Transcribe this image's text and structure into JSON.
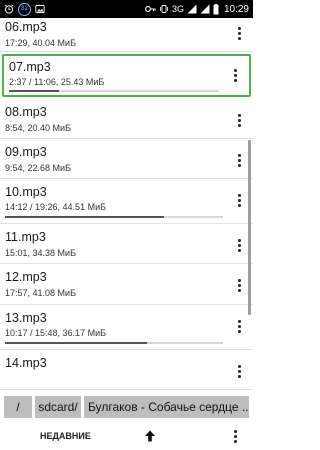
{
  "status_bar": {
    "badge_number": "82",
    "network": "3G",
    "time": "10:29"
  },
  "tracks": [
    {
      "name": "06.mp3",
      "info": "17:29, 40.04 МиБ",
      "progress": 0
    },
    {
      "name": "07.mp3",
      "info": "2:37 / 11:06, 25.43 МиБ",
      "progress": 0.24,
      "selected": true
    },
    {
      "name": "08.mp3",
      "info": "8:54, 20.40 МиБ",
      "progress": 0
    },
    {
      "name": "09.mp3",
      "info": "9:54, 22.68 МиБ",
      "progress": 0
    },
    {
      "name": "10.mp3",
      "info": "14:12 / 19:26, 44.51 МиБ",
      "progress": 0.73
    },
    {
      "name": "11.mp3",
      "info": "15:01, 34.38 МиБ",
      "progress": 0
    },
    {
      "name": "12.mp3",
      "info": "17:57, 41.08 МиБ",
      "progress": 0
    },
    {
      "name": "13.mp3",
      "info": "10:17 / 15:48, 36.17 МиБ",
      "progress": 0.65
    },
    {
      "name": "14.mp3",
      "info": "",
      "progress": 0
    }
  ],
  "path": {
    "root": "/",
    "sdcard": "sdcard/",
    "folder": "Булгаков - Собачье сердце ...",
    "trail": "/"
  },
  "bottom_bar": {
    "recent_label": "НЕДАВНИЕ",
    "up_icon": "arrow-up-icon",
    "menu_icon": "overflow-menu-icon"
  },
  "colors": {
    "selected_border": "#4caf50",
    "crumb_bg": "#bdbdbd",
    "progress_fill": "#555555"
  }
}
